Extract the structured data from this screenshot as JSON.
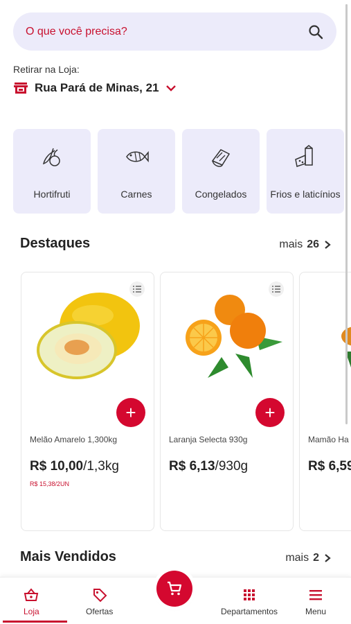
{
  "search": {
    "placeholder": "O que você precisa?"
  },
  "pickup": {
    "label": "Retirar na Loja:",
    "store": "Rua Pará de Minas, 21"
  },
  "categories": [
    {
      "label": "Hortifruti",
      "icon": "vegetables-icon"
    },
    {
      "label": "Carnes",
      "icon": "fish-icon"
    },
    {
      "label": "Congelados",
      "icon": "frozen-icon"
    },
    {
      "label": "Frios e laticínios",
      "icon": "dairy-icon"
    }
  ],
  "highlights": {
    "title": "Destaques",
    "more_label": "mais",
    "more_count": "26"
  },
  "products": [
    {
      "name": "Melão Amarelo 1,300kg",
      "price": "R$ 10,00",
      "unit": "/1,3kg",
      "unit_price": "R$ 15,38/2UN"
    },
    {
      "name": "Laranja Selecta 930g",
      "price": "R$ 6,13",
      "unit": "/930g",
      "unit_price": ""
    },
    {
      "name": "Mamão Ha",
      "price": "R$ 6,59",
      "unit": "",
      "unit_price": ""
    }
  ],
  "best_sellers": {
    "title": "Mais Vendidos",
    "more_label": "mais",
    "more_count": "2"
  },
  "nav": {
    "store": "Loja",
    "offers": "Ofertas",
    "departments": "Departamentos",
    "menu": "Menu"
  },
  "colors": {
    "accent": "#c8102e",
    "card_bg": "#ecebfa"
  }
}
